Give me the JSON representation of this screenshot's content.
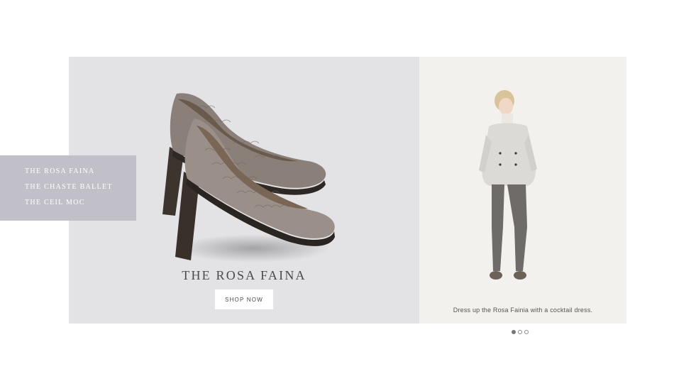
{
  "product_nav": {
    "items": [
      {
        "label": "THE ROSA FAINA"
      },
      {
        "label": "THE CHASTE BALLET"
      },
      {
        "label": "THE CEIL MOC"
      }
    ]
  },
  "product": {
    "title": "THE ROSA FAINA",
    "cta_label": "SHOP NOW"
  },
  "lifestyle": {
    "caption": "Dress up the Rosa Fainia with a cocktail dress."
  },
  "carousel": {
    "total_slides": 3,
    "active_slide": 1
  },
  "colors": {
    "product_bg": "#e3e3e5",
    "nav_bg": "#c1c0c8",
    "lifestyle_bg": "#f3f1ed"
  }
}
